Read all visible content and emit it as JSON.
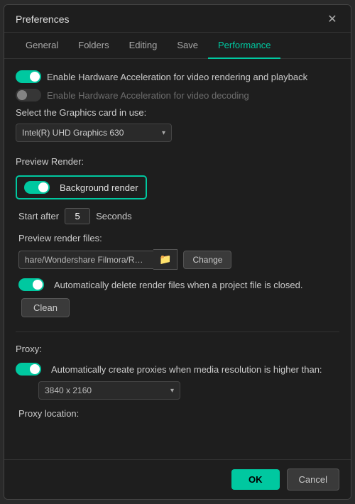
{
  "dialog": {
    "title": "Preferences",
    "close_label": "✕"
  },
  "tabs": [
    {
      "label": "General",
      "active": false
    },
    {
      "label": "Folders",
      "active": false
    },
    {
      "label": "Editing",
      "active": false
    },
    {
      "label": "Save",
      "active": false
    },
    {
      "label": "Performance",
      "active": true
    }
  ],
  "performance": {
    "hw_accel_label": "Enable Hardware Acceleration for video rendering and playback",
    "hw_decode_label": "Enable Hardware Acceleration for video decoding",
    "graphics_card_label": "Select the Graphics card in use:",
    "graphics_card_value": "Intel(R) UHD Graphics 630",
    "preview_render_label": "Preview Render:",
    "bg_render_label": "Background render",
    "start_after_label": "Start after",
    "start_after_value": "5",
    "seconds_label": "Seconds",
    "render_files_label": "Preview render files:",
    "render_path_value": "hare/Wondershare Filmora/Render",
    "change_btn_label": "Change",
    "auto_delete_label": "Automatically delete render files when a project file is closed.",
    "clean_btn_label": "Clean",
    "proxy_label": "Proxy:",
    "auto_proxy_label": "Automatically create proxies when media resolution is higher than:",
    "proxy_resolution_value": "3840 x 2160",
    "proxy_location_label": "Proxy location:"
  },
  "footer": {
    "ok_label": "OK",
    "cancel_label": "Cancel"
  }
}
